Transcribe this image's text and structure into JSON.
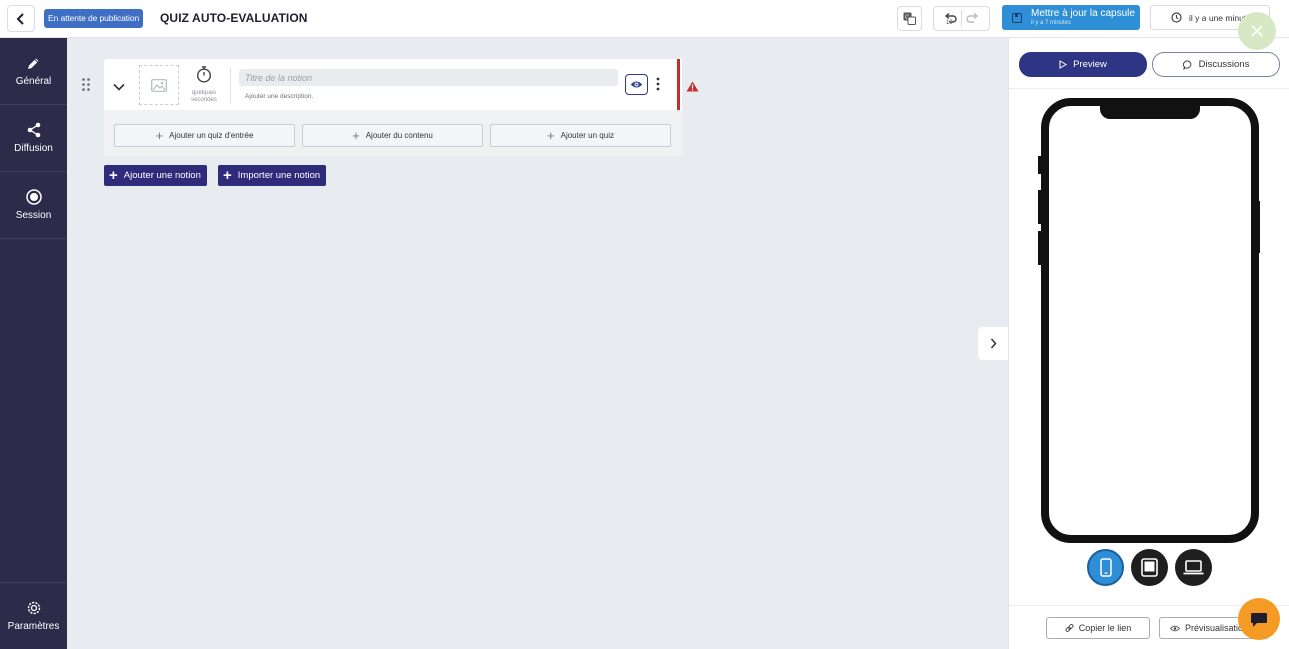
{
  "header": {
    "back_icon": "chevron-left-icon",
    "status_badge": "En attente de publication",
    "title": "QUIZ AUTO-EVALUATION",
    "translate_icon": "translate-icon",
    "undo_count": "19",
    "update_button": {
      "label": "Mettre à jour la capsule",
      "sub": "il y a 7 minutes"
    },
    "history_label": "il y a une minute",
    "close_icon": "close-icon"
  },
  "sidebar": {
    "items": [
      {
        "label": "Général",
        "icon": "pencil-icon"
      },
      {
        "label": "Diffusion",
        "icon": "share-icon"
      },
      {
        "label": "Session",
        "icon": "record-icon"
      }
    ],
    "settings": {
      "label": "Paramètres",
      "icon": "gear-icon"
    }
  },
  "notion": {
    "timer_text_line1": "quelques",
    "timer_text_line2": "secondes",
    "title_placeholder": "Titre de la notion",
    "description": "Ajouter une description.",
    "actions": [
      "Ajouter un quiz d'entrée",
      "Ajouter du contenu",
      "Ajouter un quiz"
    ]
  },
  "main": {
    "add_notion": "Ajouter une notion",
    "import_notion": "Importer une notion"
  },
  "preview_panel": {
    "tab_preview": "Preview",
    "tab_discussions": "Discussions",
    "devices": [
      "phone-icon",
      "tablet-icon",
      "laptop-icon"
    ],
    "active_device": "phone-icon",
    "copy_link": "Copier le lien",
    "preview_link": "Prévisualisation"
  },
  "colors": {
    "sidebar": "#2e2b4a",
    "primary": "#2e2b7a",
    "accent": "#2e8fd6",
    "warning": "#c0302e",
    "chat": "#f59a24"
  }
}
